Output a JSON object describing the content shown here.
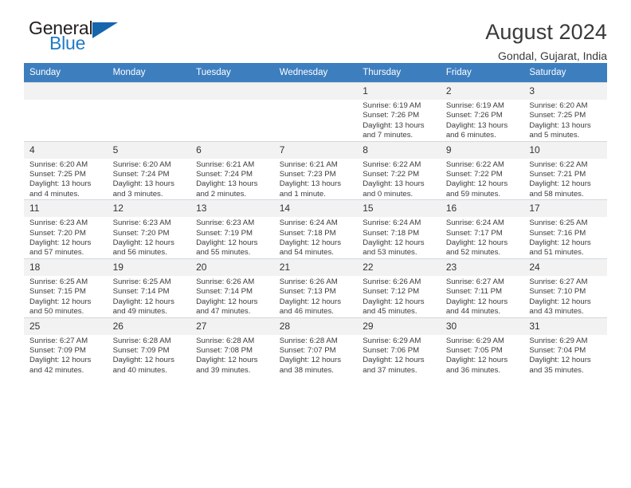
{
  "brand": {
    "name_part1": "General",
    "name_part2": "Blue",
    "triangle_color": "#1565ad",
    "blue_color": "#1f7ac7"
  },
  "header": {
    "month_title": "August 2024",
    "location": "Gondal, Gujarat, India"
  },
  "theme": {
    "header_row_bg": "#3d7ebf",
    "daynum_bg": "#f2f2f2",
    "grid_line": "#cfd6dd",
    "text": "#3b3b3b"
  },
  "weekdays": [
    "Sunday",
    "Monday",
    "Tuesday",
    "Wednesday",
    "Thursday",
    "Friday",
    "Saturday"
  ],
  "weeks": [
    [
      {
        "day": "",
        "sunrise": "",
        "sunset": "",
        "daylight_line1": "",
        "daylight_line2": "",
        "empty": true
      },
      {
        "day": "",
        "sunrise": "",
        "sunset": "",
        "daylight_line1": "",
        "daylight_line2": "",
        "empty": true
      },
      {
        "day": "",
        "sunrise": "",
        "sunset": "",
        "daylight_line1": "",
        "daylight_line2": "",
        "empty": true
      },
      {
        "day": "",
        "sunrise": "",
        "sunset": "",
        "daylight_line1": "",
        "daylight_line2": "",
        "empty": true
      },
      {
        "day": "1",
        "sunrise": "Sunrise: 6:19 AM",
        "sunset": "Sunset: 7:26 PM",
        "daylight_line1": "Daylight: 13 hours",
        "daylight_line2": "and 7 minutes."
      },
      {
        "day": "2",
        "sunrise": "Sunrise: 6:19 AM",
        "sunset": "Sunset: 7:26 PM",
        "daylight_line1": "Daylight: 13 hours",
        "daylight_line2": "and 6 minutes."
      },
      {
        "day": "3",
        "sunrise": "Sunrise: 6:20 AM",
        "sunset": "Sunset: 7:25 PM",
        "daylight_line1": "Daylight: 13 hours",
        "daylight_line2": "and 5 minutes."
      }
    ],
    [
      {
        "day": "4",
        "sunrise": "Sunrise: 6:20 AM",
        "sunset": "Sunset: 7:25 PM",
        "daylight_line1": "Daylight: 13 hours",
        "daylight_line2": "and 4 minutes."
      },
      {
        "day": "5",
        "sunrise": "Sunrise: 6:20 AM",
        "sunset": "Sunset: 7:24 PM",
        "daylight_line1": "Daylight: 13 hours",
        "daylight_line2": "and 3 minutes."
      },
      {
        "day": "6",
        "sunrise": "Sunrise: 6:21 AM",
        "sunset": "Sunset: 7:24 PM",
        "daylight_line1": "Daylight: 13 hours",
        "daylight_line2": "and 2 minutes."
      },
      {
        "day": "7",
        "sunrise": "Sunrise: 6:21 AM",
        "sunset": "Sunset: 7:23 PM",
        "daylight_line1": "Daylight: 13 hours",
        "daylight_line2": "and 1 minute."
      },
      {
        "day": "8",
        "sunrise": "Sunrise: 6:22 AM",
        "sunset": "Sunset: 7:22 PM",
        "daylight_line1": "Daylight: 13 hours",
        "daylight_line2": "and 0 minutes."
      },
      {
        "day": "9",
        "sunrise": "Sunrise: 6:22 AM",
        "sunset": "Sunset: 7:22 PM",
        "daylight_line1": "Daylight: 12 hours",
        "daylight_line2": "and 59 minutes."
      },
      {
        "day": "10",
        "sunrise": "Sunrise: 6:22 AM",
        "sunset": "Sunset: 7:21 PM",
        "daylight_line1": "Daylight: 12 hours",
        "daylight_line2": "and 58 minutes."
      }
    ],
    [
      {
        "day": "11",
        "sunrise": "Sunrise: 6:23 AM",
        "sunset": "Sunset: 7:20 PM",
        "daylight_line1": "Daylight: 12 hours",
        "daylight_line2": "and 57 minutes."
      },
      {
        "day": "12",
        "sunrise": "Sunrise: 6:23 AM",
        "sunset": "Sunset: 7:20 PM",
        "daylight_line1": "Daylight: 12 hours",
        "daylight_line2": "and 56 minutes."
      },
      {
        "day": "13",
        "sunrise": "Sunrise: 6:23 AM",
        "sunset": "Sunset: 7:19 PM",
        "daylight_line1": "Daylight: 12 hours",
        "daylight_line2": "and 55 minutes."
      },
      {
        "day": "14",
        "sunrise": "Sunrise: 6:24 AM",
        "sunset": "Sunset: 7:18 PM",
        "daylight_line1": "Daylight: 12 hours",
        "daylight_line2": "and 54 minutes."
      },
      {
        "day": "15",
        "sunrise": "Sunrise: 6:24 AM",
        "sunset": "Sunset: 7:18 PM",
        "daylight_line1": "Daylight: 12 hours",
        "daylight_line2": "and 53 minutes."
      },
      {
        "day": "16",
        "sunrise": "Sunrise: 6:24 AM",
        "sunset": "Sunset: 7:17 PM",
        "daylight_line1": "Daylight: 12 hours",
        "daylight_line2": "and 52 minutes."
      },
      {
        "day": "17",
        "sunrise": "Sunrise: 6:25 AM",
        "sunset": "Sunset: 7:16 PM",
        "daylight_line1": "Daylight: 12 hours",
        "daylight_line2": "and 51 minutes."
      }
    ],
    [
      {
        "day": "18",
        "sunrise": "Sunrise: 6:25 AM",
        "sunset": "Sunset: 7:15 PM",
        "daylight_line1": "Daylight: 12 hours",
        "daylight_line2": "and 50 minutes."
      },
      {
        "day": "19",
        "sunrise": "Sunrise: 6:25 AM",
        "sunset": "Sunset: 7:14 PM",
        "daylight_line1": "Daylight: 12 hours",
        "daylight_line2": "and 49 minutes."
      },
      {
        "day": "20",
        "sunrise": "Sunrise: 6:26 AM",
        "sunset": "Sunset: 7:14 PM",
        "daylight_line1": "Daylight: 12 hours",
        "daylight_line2": "and 47 minutes."
      },
      {
        "day": "21",
        "sunrise": "Sunrise: 6:26 AM",
        "sunset": "Sunset: 7:13 PM",
        "daylight_line1": "Daylight: 12 hours",
        "daylight_line2": "and 46 minutes."
      },
      {
        "day": "22",
        "sunrise": "Sunrise: 6:26 AM",
        "sunset": "Sunset: 7:12 PM",
        "daylight_line1": "Daylight: 12 hours",
        "daylight_line2": "and 45 minutes."
      },
      {
        "day": "23",
        "sunrise": "Sunrise: 6:27 AM",
        "sunset": "Sunset: 7:11 PM",
        "daylight_line1": "Daylight: 12 hours",
        "daylight_line2": "and 44 minutes."
      },
      {
        "day": "24",
        "sunrise": "Sunrise: 6:27 AM",
        "sunset": "Sunset: 7:10 PM",
        "daylight_line1": "Daylight: 12 hours",
        "daylight_line2": "and 43 minutes."
      }
    ],
    [
      {
        "day": "25",
        "sunrise": "Sunrise: 6:27 AM",
        "sunset": "Sunset: 7:09 PM",
        "daylight_line1": "Daylight: 12 hours",
        "daylight_line2": "and 42 minutes."
      },
      {
        "day": "26",
        "sunrise": "Sunrise: 6:28 AM",
        "sunset": "Sunset: 7:09 PM",
        "daylight_line1": "Daylight: 12 hours",
        "daylight_line2": "and 40 minutes."
      },
      {
        "day": "27",
        "sunrise": "Sunrise: 6:28 AM",
        "sunset": "Sunset: 7:08 PM",
        "daylight_line1": "Daylight: 12 hours",
        "daylight_line2": "and 39 minutes."
      },
      {
        "day": "28",
        "sunrise": "Sunrise: 6:28 AM",
        "sunset": "Sunset: 7:07 PM",
        "daylight_line1": "Daylight: 12 hours",
        "daylight_line2": "and 38 minutes."
      },
      {
        "day": "29",
        "sunrise": "Sunrise: 6:29 AM",
        "sunset": "Sunset: 7:06 PM",
        "daylight_line1": "Daylight: 12 hours",
        "daylight_line2": "and 37 minutes."
      },
      {
        "day": "30",
        "sunrise": "Sunrise: 6:29 AM",
        "sunset": "Sunset: 7:05 PM",
        "daylight_line1": "Daylight: 12 hours",
        "daylight_line2": "and 36 minutes."
      },
      {
        "day": "31",
        "sunrise": "Sunrise: 6:29 AM",
        "sunset": "Sunset: 7:04 PM",
        "daylight_line1": "Daylight: 12 hours",
        "daylight_line2": "and 35 minutes."
      }
    ]
  ]
}
